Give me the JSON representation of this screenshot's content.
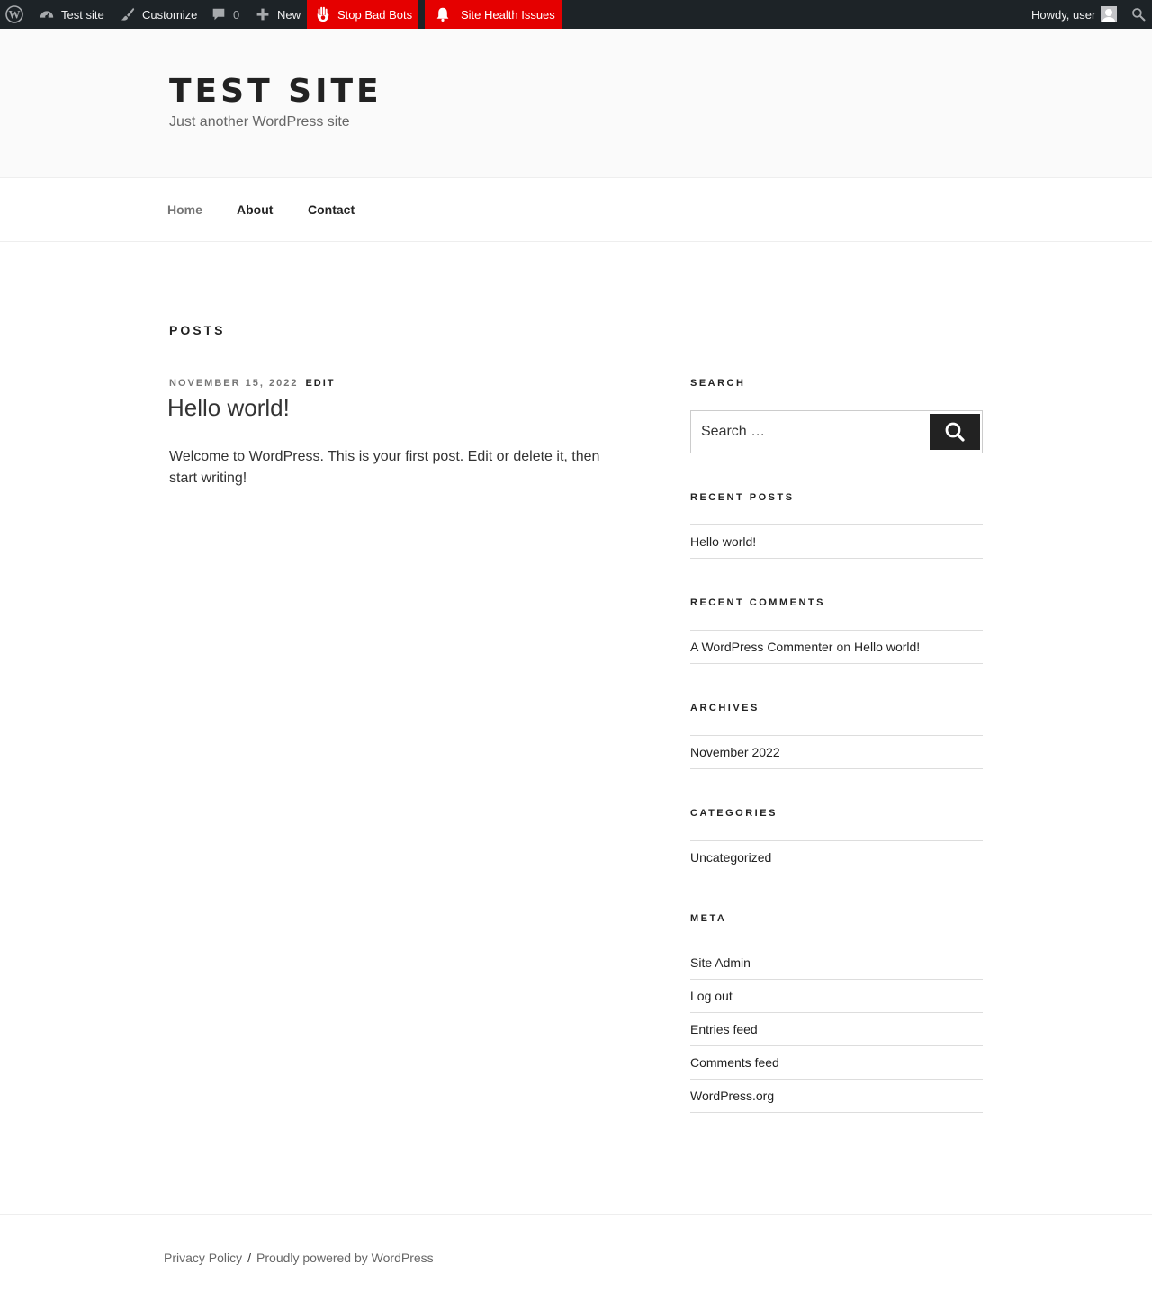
{
  "adminbar": {
    "site_name": "Test site",
    "customize": "Customize",
    "comments_count": "0",
    "new": "New",
    "stop_bad_bots": "Stop Bad Bots",
    "site_health": "Site Health Issues",
    "howdy": "Howdy, user",
    "colors": {
      "bar": "#1d2327",
      "alert": "#e50000"
    }
  },
  "header": {
    "title": "TEST SITE",
    "description": "Just another WordPress site"
  },
  "nav": {
    "items": [
      {
        "label": "Home"
      },
      {
        "label": "About"
      },
      {
        "label": "Contact"
      }
    ]
  },
  "main": {
    "page_title": "POSTS",
    "post": {
      "date": "NOVEMBER 15, 2022",
      "edit": "EDIT",
      "title": "Hello world!",
      "content": "Welcome to WordPress. This is your first post. Edit or delete it, then start writing!"
    }
  },
  "sidebar": {
    "search": {
      "title": "SEARCH",
      "placeholder": "Search …",
      "button_icon": "search-icon"
    },
    "recent_posts": {
      "title": "RECENT POSTS",
      "items": [
        "Hello world!"
      ]
    },
    "recent_comments": {
      "title": "RECENT COMMENTS",
      "author": "A WordPress Commenter",
      "on": "on",
      "post": "Hello world!"
    },
    "archives": {
      "title": "ARCHIVES",
      "items": [
        "November 2022"
      ]
    },
    "categories": {
      "title": "CATEGORIES",
      "items": [
        "Uncategorized"
      ]
    },
    "meta": {
      "title": "META",
      "items": [
        "Site Admin",
        "Log out",
        "Entries feed",
        "Comments feed",
        "WordPress.org"
      ]
    }
  },
  "footer": {
    "privacy": "Privacy Policy",
    "separator": "/",
    "powered": "Proudly powered by WordPress"
  }
}
